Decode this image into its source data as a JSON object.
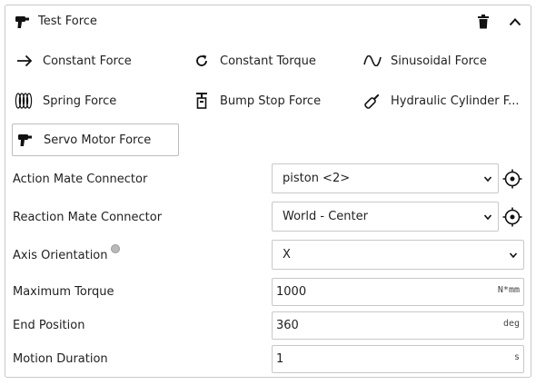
{
  "header": {
    "title": "Test Force",
    "icon": "drill-icon",
    "actions": [
      "trash-icon",
      "chevron-up-icon"
    ]
  },
  "force_types": [
    {
      "label": "Constant Force",
      "icon": "arrow-right-icon",
      "selected": false
    },
    {
      "label": "Constant Torque",
      "icon": "rotate-cw-icon",
      "selected": false
    },
    {
      "label": "Sinusoidal Force",
      "icon": "sine-wave-icon",
      "selected": false
    },
    {
      "label": "Spring Force",
      "icon": "spring-coil-icon",
      "selected": false
    },
    {
      "label": "Bump Stop Force",
      "icon": "bump-stop-icon",
      "selected": false
    },
    {
      "label": "Hydraulic Cylinder F...",
      "icon": "hydraulic-cylinder-icon",
      "selected": false
    },
    {
      "label": "Servo Motor Force",
      "icon": "drill-icon",
      "selected": true
    }
  ],
  "fields": {
    "action_mate": {
      "label": "Action Mate Connector",
      "value": "piston <2>"
    },
    "reaction_mate": {
      "label": "Reaction Mate Connector",
      "value": "World - Center"
    },
    "axis_orientation": {
      "label": "Axis Orientation",
      "value": "X"
    },
    "max_torque": {
      "label": "Maximum Torque",
      "value": "1000",
      "unit": "N*mm"
    },
    "end_position": {
      "label": "End Position",
      "value": "360",
      "unit": "deg"
    },
    "motion_duration": {
      "label": "Motion Duration",
      "value": "1",
      "unit": "s"
    }
  }
}
